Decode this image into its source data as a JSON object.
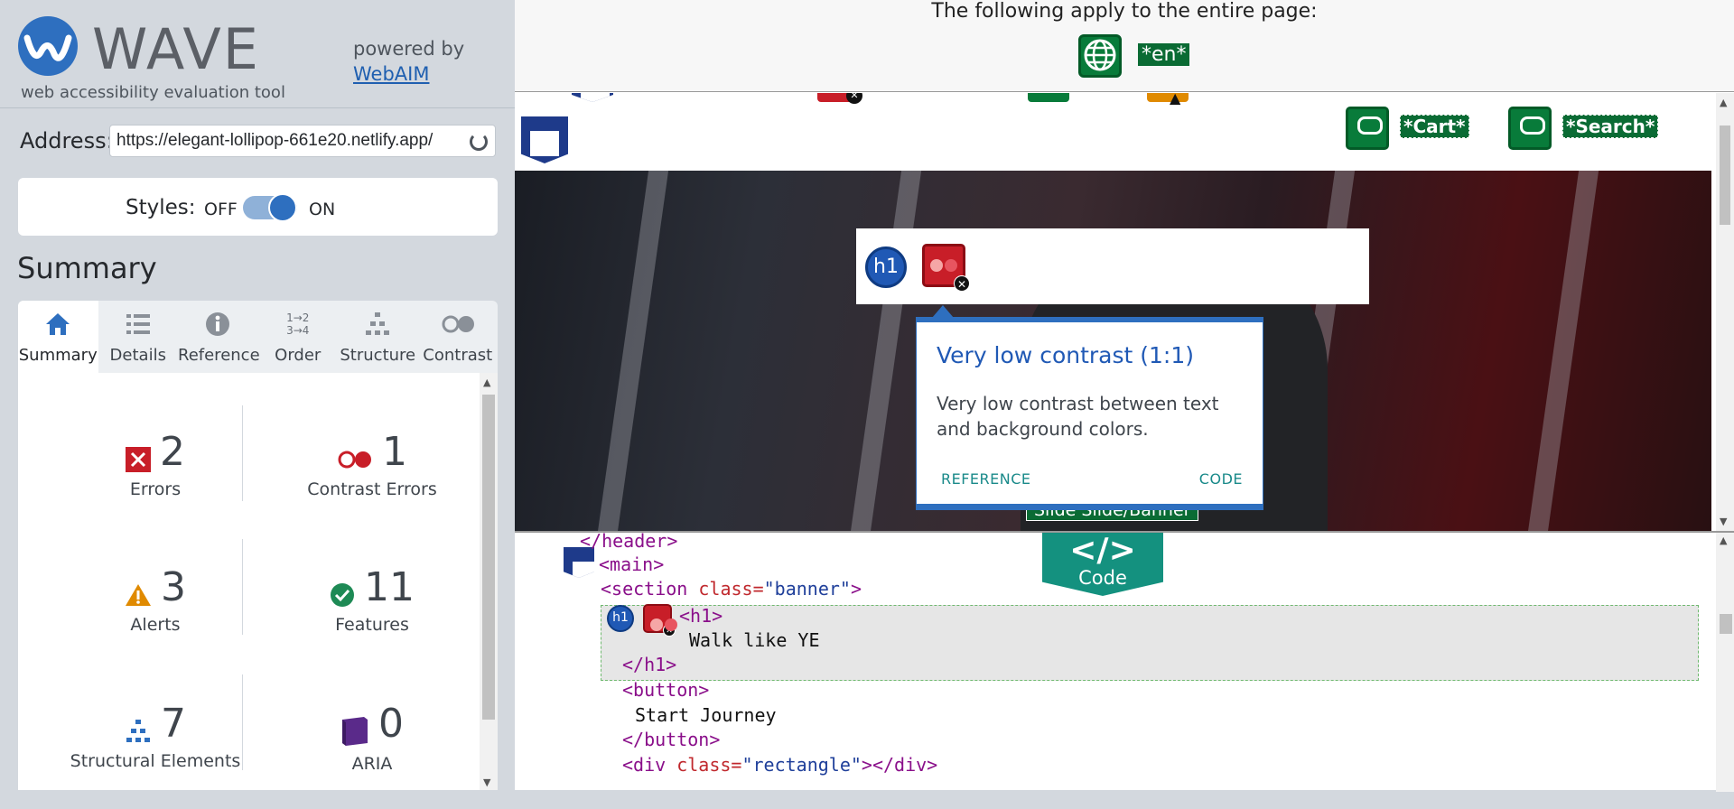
{
  "sidebar": {
    "logo_title": "WAVE",
    "logo_subtitle": "web accessibility evaluation tool",
    "powered_by": "powered by",
    "webaim_link": "WebAIM",
    "address_label": "Address:",
    "address_value": "https://elegant-lollipop-661e20.netlify.app/",
    "styles_label": "Styles:",
    "styles_off": "OFF",
    "styles_on": "ON",
    "styles_state": "on",
    "summary_heading": "Summary",
    "tabs": [
      {
        "label": "Summary",
        "icon": "home-icon",
        "active": true
      },
      {
        "label": "Details",
        "icon": "list-icon"
      },
      {
        "label": "Reference",
        "icon": "info-icon"
      },
      {
        "label": "Order",
        "icon": "order-icon"
      },
      {
        "label": "Structure",
        "icon": "structure-icon"
      },
      {
        "label": "Contrast",
        "icon": "contrast-icon"
      }
    ],
    "stats": {
      "errors": {
        "count": "2",
        "label": "Errors"
      },
      "contrast_errors": {
        "count": "1",
        "label": "Contrast Errors"
      },
      "alerts": {
        "count": "3",
        "label": "Alerts"
      },
      "features": {
        "count": "11",
        "label": "Features"
      },
      "structural": {
        "count": "7",
        "label": "Structural Elements"
      },
      "aria": {
        "count": "0",
        "label": "ARIA"
      }
    }
  },
  "page": {
    "entire_page_text": "The following apply to the entire page:",
    "lang_badge": "*en*",
    "cart_link": "*Cart*",
    "search_link": "*Search*",
    "h1_icon_label": "h1",
    "slide_label": "Slide Slide/Banner",
    "popup": {
      "title": "Very low contrast (1:1)",
      "body": "Very low contrast between text and background colors.",
      "reference": "REFERENCE",
      "code": "CODE"
    }
  },
  "code": {
    "toggle_symbol": "</>",
    "toggle_label": "Code",
    "lines": {
      "l1": "</header>",
      "l2": "<main>",
      "l3_tag_open": "<section ",
      "l3_attr": "class=",
      "l3_val": "\"banner\"",
      "l3_close": ">",
      "l4": "<h1>",
      "l5": "Walk like YE",
      "l6": "</h1>",
      "l7": "<button>",
      "l8": "Start Journey",
      "l9": "</button>",
      "l10_tag_open": "<div ",
      "l10_attr": "class=",
      "l10_val": "\"rectangle\"",
      "l10_close": "></div>"
    }
  },
  "colors": {
    "wave_blue": "#2e6fbf",
    "error_red": "#c81e28",
    "feature_green": "#087b3a",
    "alert_orange": "#e08a00",
    "aria_purple": "#5a2a8a",
    "code_teal": "#14917f"
  }
}
